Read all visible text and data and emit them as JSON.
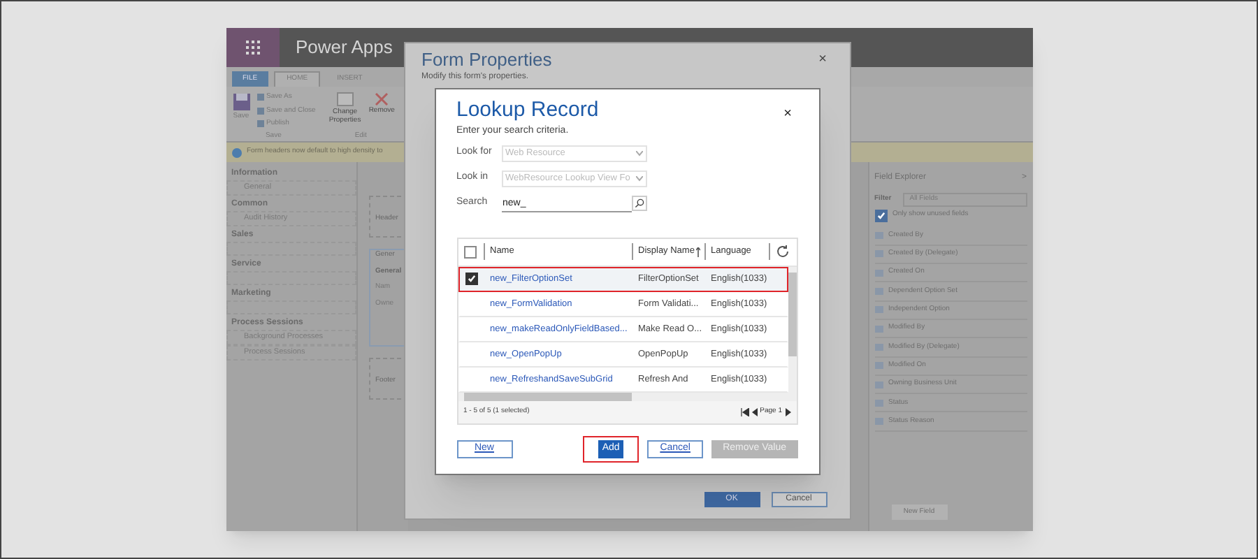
{
  "app": {
    "title": "Power Apps"
  },
  "ribbon_tabs": [
    {
      "label": "FILE",
      "selected": false,
      "kind": "file"
    },
    {
      "label": "HOME",
      "selected": true,
      "kind": "tab"
    },
    {
      "label": "INSERT",
      "selected": false,
      "kind": "tab"
    }
  ],
  "ribbon": {
    "save": "Save",
    "small_commands": [
      "Save As",
      "Save and Close",
      "Publish"
    ],
    "save_group": "Save",
    "change_properties": "Change Properties",
    "remove": "Remove",
    "edit_group": "Edit"
  },
  "notification": "Form headers now default to high density to",
  "nav": [
    {
      "label": "Information",
      "children": [
        {
          "label": "General"
        }
      ]
    },
    {
      "label": "Common",
      "children": [
        {
          "label": "Audit History"
        }
      ]
    },
    {
      "label": "Sales"
    },
    {
      "label": "Service"
    },
    {
      "label": "Marketing"
    },
    {
      "label": "Process Sessions",
      "children": [
        {
          "label": "Background Processes"
        },
        {
          "label": "Process Sessions"
        }
      ]
    }
  ],
  "form_canvas": {
    "header": "Header",
    "tab": "Gener",
    "section": "General",
    "fields": [
      "Nam",
      "Owne"
    ],
    "footer": "Footer"
  },
  "field_explorer": {
    "title": "Field Explorer",
    "collapse": ">",
    "filter_label": "Filter",
    "filter_value": "All Fields",
    "unused_only": {
      "label": "Only show unused fields",
      "checked": true
    },
    "fields": [
      "Created By",
      "Created By (Delegate)",
      "Created On",
      "Dependent Option Set",
      "Independent Option",
      "Modified By",
      "Modified By (Delegate)",
      "Modified On",
      "Owning Business Unit",
      "Status",
      "Status Reason"
    ],
    "new_field": "New Field"
  },
  "form_properties": {
    "title": "Form Properties",
    "subtitle": "Modify this form's properties.",
    "close": "×",
    "buttons": [
      "OK",
      "Cancel"
    ]
  },
  "lookup": {
    "title": "Lookup Record",
    "subtitle": "Enter your search criteria.",
    "close": "×",
    "look_for": {
      "label": "Look for",
      "value": "Web Resource",
      "disabled": true
    },
    "look_in": {
      "label": "Look in",
      "value": "WebResource Lookup View Fo",
      "disabled": true
    },
    "search": {
      "label": "Search",
      "value": "new_"
    },
    "all_selected": false,
    "columns": [
      "Name",
      "Display Name",
      "Language"
    ],
    "rows": [
      {
        "name": "new_FilterOptionSet",
        "display_name": "FilterOptionSet",
        "language": "English(1033)",
        "selected": true,
        "highlighted": true
      },
      {
        "name": "new_FormValidation",
        "display_name": "Form Validati...",
        "language": "English(1033)",
        "selected": false,
        "highlighted": false
      },
      {
        "name": "new_makeReadOnlyFieldBased...",
        "display_name": "Make Read O...",
        "language": "English(1033)",
        "selected": false,
        "highlighted": false
      },
      {
        "name": "new_OpenPopUp",
        "display_name": "OpenPopUp",
        "language": "English(1033)",
        "selected": false,
        "highlighted": false
      },
      {
        "name": "new_RefreshandSaveSubGrid",
        "display_name": "Refresh And",
        "language": "English(1033)",
        "selected": false,
        "highlighted": false
      }
    ],
    "status": "1 - 5 of 5 (1 selected)",
    "page": "Page 1",
    "buttons": [
      {
        "label": "New",
        "kind": "secondary",
        "highlighted": false
      },
      {
        "label": "Add",
        "kind": "primary",
        "highlighted": true
      },
      {
        "label": "Cancel",
        "kind": "secondary",
        "highlighted": false
      },
      {
        "label": "Remove Value",
        "kind": "disabled",
        "highlighted": false
      }
    ]
  }
}
